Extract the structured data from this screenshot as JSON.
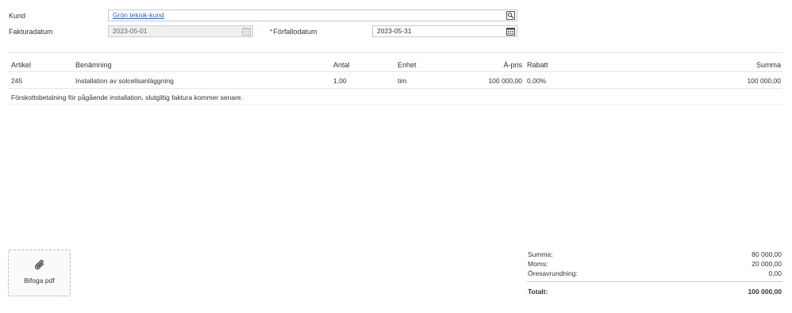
{
  "header": {
    "customer_label": "Kund",
    "customer_value": "Grön teknik-kund",
    "invoice_date_label": "Fakturadatum",
    "invoice_date_value": "2023-05-01",
    "due_date_required_mark": "*",
    "due_date_label": "Förfallodatum",
    "due_date_value": "2023-05-31"
  },
  "table": {
    "columns": {
      "article": "Artikel",
      "description": "Benämning",
      "quantity": "Antal",
      "unit": "Enhet",
      "unit_price": "À-pris",
      "discount": "Rabatt",
      "sum": "Summa"
    },
    "rows": [
      {
        "article": "245",
        "description": "Installation av solcellsanläggning",
        "quantity": "1,00",
        "unit": "tim",
        "unit_price": "100 000,00",
        "discount": "0,00%",
        "sum": "100 000,00"
      }
    ],
    "note": "Förskottsbetalning för pågående installation, slutgiltig faktura kommer senare."
  },
  "attach": {
    "label": "Bifoga pdf",
    "icon": "paperclip-icon"
  },
  "totals": {
    "sum_label": "Summa:",
    "sum_value": "80 000,00",
    "vat_label": "Moms:",
    "vat_value": "20 000,00",
    "rounding_label": "Öresavrundning:",
    "rounding_value": "0,00",
    "total_label": "Totalt:",
    "total_value": "100 000,00"
  },
  "colors": {
    "link": "#2a6aaf",
    "required": "#c0392b",
    "border": "#c8c8c8",
    "disabled_bg": "#f0f0f0"
  }
}
